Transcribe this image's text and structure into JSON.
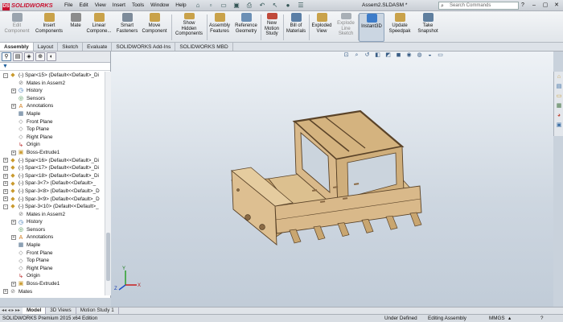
{
  "app": {
    "logo_text": "SOLIDWORKS",
    "menu": [
      "File",
      "Edit",
      "View",
      "Insert",
      "Tools",
      "Window",
      "Help"
    ],
    "document_title": "Assem2.SLDASM *",
    "search_placeholder": "Search Commands"
  },
  "ribbon": {
    "buttons": [
      {
        "label_1": "Edit",
        "label_2": "Component",
        "color": "#9aa4ae"
      },
      {
        "label_1": "Insert",
        "label_2": "Components",
        "color": "#c9a24a"
      },
      {
        "label_1": "Mate",
        "label_2": "",
        "color": "#8c8c8c"
      },
      {
        "label_1": "Linear",
        "label_2": "Compone...",
        "color": "#c9a24a"
      },
      {
        "label_1": "Smart",
        "label_2": "Fasteners",
        "color": "#7d8b9a"
      },
      {
        "label_1": "Move",
        "label_2": "Component",
        "color": "#c9a24a"
      },
      {
        "label_1": "Show",
        "label_2": "Hidden",
        "label_3": "Components",
        "color": "#c9a24a"
      },
      {
        "label_1": "Assembly",
        "label_2": "Features",
        "color": "#c9a24a"
      },
      {
        "label_1": "Reference",
        "label_2": "Geometry",
        "color": "#6b8fb5"
      },
      {
        "label_1": "New",
        "label_2": "Motion",
        "label_3": "Study",
        "color": "#c04a3a"
      },
      {
        "label_1": "Bill of",
        "label_2": "Materials",
        "color": "#5b7fa6"
      },
      {
        "label_1": "Exploded",
        "label_2": "View",
        "color": "#c9a24a"
      },
      {
        "label_1": "Explode",
        "label_2": "Line",
        "label_3": "Sketch",
        "color": "#a8afb6"
      },
      {
        "label_1": "Instant3D",
        "label_2": "",
        "color": "#3d7cc9"
      },
      {
        "label_1": "Update",
        "label_2": "Speedpak",
        "color": "#c9a24a"
      },
      {
        "label_1": "Take",
        "label_2": "Snapshot",
        "color": "#5f7f9f"
      }
    ]
  },
  "command_tabs": [
    "Assembly",
    "Layout",
    "Sketch",
    "Evaluate",
    "SOLIDWORKS Add-Ins",
    "SOLIDWORKS MBD"
  ],
  "feature_tree": {
    "rows": [
      {
        "label": "(-) Spar<15> (Default<<Default>_Di",
        "indent": 0,
        "icon": "part",
        "exp": "-"
      },
      {
        "label": "Mates in Assem2",
        "indent": 1,
        "icon": "mate",
        "exp": ""
      },
      {
        "label": "History",
        "indent": 1,
        "icon": "hist",
        "exp": "+"
      },
      {
        "label": "Sensors",
        "indent": 1,
        "icon": "sensor",
        "exp": ""
      },
      {
        "label": "Annotations",
        "indent": 1,
        "icon": "ann",
        "exp": "+"
      },
      {
        "label": "Maple",
        "indent": 1,
        "icon": "mat",
        "exp": ""
      },
      {
        "label": "Front Plane",
        "indent": 1,
        "icon": "plane",
        "exp": ""
      },
      {
        "label": "Top Plane",
        "indent": 1,
        "icon": "plane",
        "exp": ""
      },
      {
        "label": "Right Plane",
        "indent": 1,
        "icon": "plane",
        "exp": ""
      },
      {
        "label": "Origin",
        "indent": 1,
        "icon": "origin",
        "exp": ""
      },
      {
        "label": "Boss-Extrude1",
        "indent": 1,
        "icon": "feat",
        "exp": "+"
      },
      {
        "label": "(-) Spar<16> (Default<<Default>_Di",
        "indent": 0,
        "icon": "part",
        "exp": "+"
      },
      {
        "label": "(-) Spar<17> (Default<<Default>_Di",
        "indent": 0,
        "icon": "part",
        "exp": "+"
      },
      {
        "label": "(-) Spar<18> (Default<<Default>_Di",
        "indent": 0,
        "icon": "part",
        "exp": "+"
      },
      {
        "label": "(-) Spar-3<7> (Default<<Default>_",
        "indent": 0,
        "icon": "part",
        "exp": "+"
      },
      {
        "label": "(-) Spar-3<8> (Default<<Default>_D",
        "indent": 0,
        "icon": "part",
        "exp": "+"
      },
      {
        "label": "(-) Spar-3<9> (Default<<Default>_D",
        "indent": 0,
        "icon": "part",
        "exp": "+"
      },
      {
        "label": "(-) Spar-3<10> (Default<<Default>_",
        "indent": 0,
        "icon": "part",
        "exp": "-"
      },
      {
        "label": "Mates in Assem2",
        "indent": 1,
        "icon": "mate",
        "exp": ""
      },
      {
        "label": "History",
        "indent": 1,
        "icon": "hist",
        "exp": "+"
      },
      {
        "label": "Sensors",
        "indent": 1,
        "icon": "sensor",
        "exp": ""
      },
      {
        "label": "Annotations",
        "indent": 1,
        "icon": "ann",
        "exp": "+"
      },
      {
        "label": "Maple",
        "indent": 1,
        "icon": "mat",
        "exp": ""
      },
      {
        "label": "Front Plane",
        "indent": 1,
        "icon": "plane",
        "exp": ""
      },
      {
        "label": "Top Plane",
        "indent": 1,
        "icon": "plane",
        "exp": ""
      },
      {
        "label": "Right Plane",
        "indent": 1,
        "icon": "plane",
        "exp": ""
      },
      {
        "label": "Origin",
        "indent": 1,
        "icon": "origin",
        "exp": ""
      },
      {
        "label": "Boss-Extrude1",
        "indent": 1,
        "icon": "feat",
        "exp": "+"
      },
      {
        "label": "Mates",
        "indent": 0,
        "icon": "mate",
        "exp": "+"
      }
    ]
  },
  "bottom_tabs": [
    "Model",
    "3D Views",
    "Motion Study 1"
  ],
  "status": {
    "edition": "SOLIDWORKS Premium 2015 x64 Edition",
    "state": "Under Defined",
    "mode": "Editing Assembly",
    "units": "MMGS"
  },
  "colors": {
    "wood": "#d9b98a",
    "wood_dark": "#b8925e",
    "wood_edge": "#5a4328"
  }
}
